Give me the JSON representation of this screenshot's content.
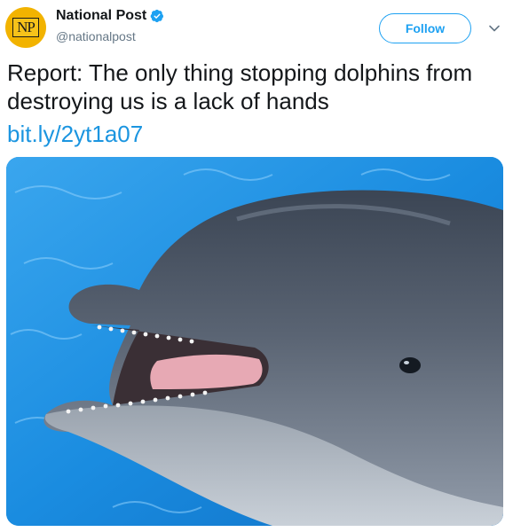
{
  "account": {
    "display_name": "National Post",
    "handle": "@nationalpost",
    "avatar_text": "NP",
    "verified": true
  },
  "actions": {
    "follow_label": "Follow"
  },
  "tweet": {
    "text": "Report: The only thing stopping dolphins from destroying us is a lack of hands",
    "link_text": "bit.ly/2yt1a07"
  },
  "media": {
    "subject": "Bottlenose dolphin with open mouth in blue pool water"
  },
  "colors": {
    "accent": "#1da1f2",
    "link": "#1b95e0",
    "avatar_bg": "#f2b300",
    "text": "#14171a",
    "muted": "#657786"
  },
  "icons": {
    "verified": "verified-badge-icon",
    "chevron": "chevron-down-icon"
  }
}
